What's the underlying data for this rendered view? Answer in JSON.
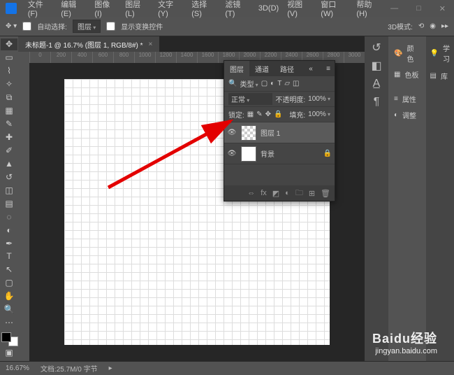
{
  "menubar": {
    "items": [
      "文件(F)",
      "编辑(E)",
      "图像(I)",
      "图层(L)",
      "文字(Y)",
      "选择(S)",
      "滤镜(T)",
      "3D(D)",
      "视图(V)",
      "窗口(W)",
      "帮助(H)"
    ]
  },
  "optbar": {
    "auto_select": "自动选择:",
    "group": "图层",
    "show_transform": "显示变换控件",
    "mode_label": "3D模式:"
  },
  "tab": {
    "title": "未标题-1 @ 16.7% (图层 1, RGB/8#) *"
  },
  "ruler": [
    "0",
    "200",
    "400",
    "600",
    "800",
    "1000",
    "1200",
    "1400",
    "1600",
    "1800",
    "2000",
    "2200",
    "2400",
    "2600",
    "2800",
    "3000"
  ],
  "layers_panel": {
    "tabs": [
      "图层",
      "通道",
      "路径"
    ],
    "kind_label": "类型",
    "blend_mode": "正常",
    "opacity_label": "不透明度:",
    "opacity_value": "100%",
    "lock_label": "锁定:",
    "fill_label": "填充:",
    "fill_value": "100%",
    "layers": [
      {
        "name": "图层 1",
        "visible": true,
        "selected": true,
        "thumb": "checker"
      },
      {
        "name": "背景",
        "visible": true,
        "selected": false,
        "thumb": "white",
        "locked": true
      }
    ]
  },
  "right_panels": {
    "items": [
      "颜色",
      "色板",
      "属性",
      "调整"
    ],
    "learn": "学习",
    "library": "库"
  },
  "statusbar": {
    "zoom": "16.67%",
    "doc_info": "文档:25.7M/0 字节"
  },
  "watermark": {
    "brand": "Baidu经验",
    "url": "jingyan.baidu.com"
  }
}
